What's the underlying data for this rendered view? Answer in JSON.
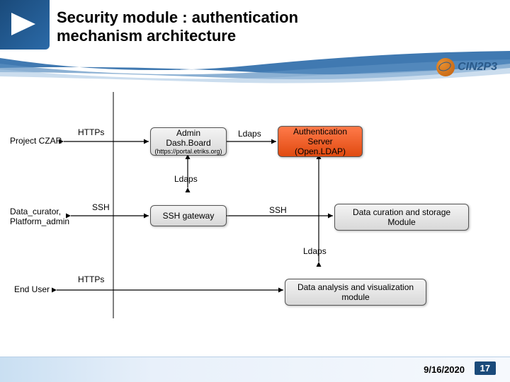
{
  "header": {
    "title": "Security module : authentication mechanism architecture",
    "logo_text": "CIN2P3"
  },
  "diagram": {
    "actors": {
      "project_czar": "Project CZAR",
      "data_curator": "Data_curator,\nPlatform_admin",
      "end_user": "End User"
    },
    "boxes": {
      "admin_dashboard": "Admin Dash.Board",
      "admin_dashboard_sub": "(https://portal.etriks.org)",
      "auth_server": "Authentication Server (Open.LDAP)",
      "ssh_gateway": "SSH gateway",
      "data_curation": "Data curation and storage Module",
      "data_analysis": "Data analysis and visualization module"
    },
    "edges": {
      "https_1": "HTTPs",
      "ldaps_1": "Ldaps",
      "ldaps_2": "Ldaps",
      "ssh_left": "SSH",
      "ssh_right": "SSH",
      "ldaps_3": "Ldaps",
      "https_2": "HTTPs"
    }
  },
  "footer": {
    "date": "9/16/2020",
    "page": "17"
  }
}
